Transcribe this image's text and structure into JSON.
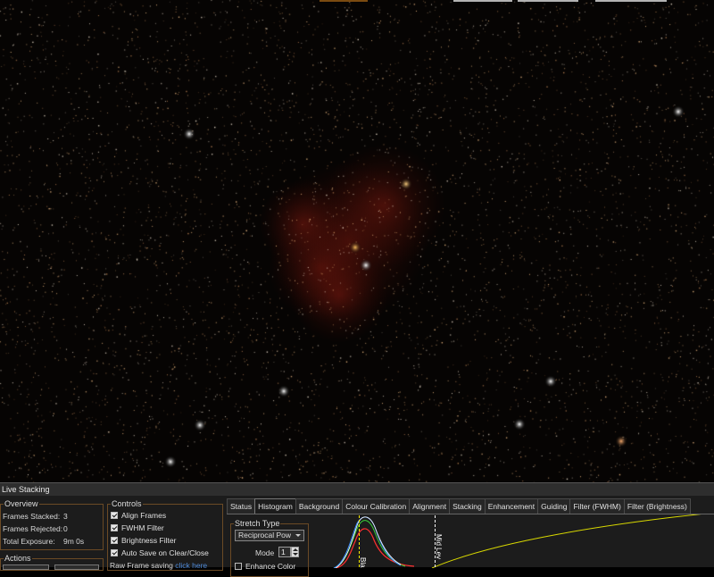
{
  "panel": {
    "title": "Live Stacking"
  },
  "overview": {
    "legend": "Overview",
    "stats": [
      {
        "label": "Frames Stacked:",
        "value": "3"
      },
      {
        "label": "Frames Rejected:",
        "value": "0"
      },
      {
        "label": "Total Exposure:",
        "value": "9m 0s"
      }
    ]
  },
  "actions": {
    "legend": "Actions"
  },
  "controls": {
    "legend": "Controls",
    "items": [
      {
        "label": "Align Frames",
        "checked": true
      },
      {
        "label": "FWHM Filter",
        "checked": true
      },
      {
        "label": "Brightness Filter",
        "checked": true
      },
      {
        "label": "Auto Save on Clear/Close",
        "checked": true
      }
    ],
    "raw_label": "Raw Frame saving",
    "raw_link": "click here"
  },
  "tabs": [
    "Status",
    "Histogram",
    "Background",
    "Colour Calibration",
    "Alignment",
    "Stacking",
    "Enhancement",
    "Guiding",
    "Filter (FWHM)",
    "Filter (Brightness)"
  ],
  "active_tab": "Histogram",
  "stretch": {
    "legend": "Stretch Type",
    "type": "Reciprocal Pow",
    "mode_label": "Mode",
    "mode_value": "1",
    "enhance_label": "Enhance Color",
    "enhance_checked": false
  },
  "histogram": {
    "black_label": "Blac",
    "mid_label": "Mid Lev"
  },
  "colors": {
    "accent_border": "#6b4a25",
    "marker": "#ffee00",
    "curve": "#d8d800"
  }
}
